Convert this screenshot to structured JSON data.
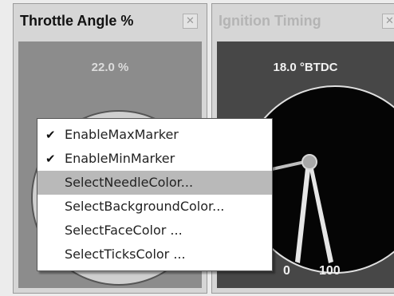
{
  "panels": {
    "throttle": {
      "title": "Throttle Angle  %",
      "close_icon": "close-icon",
      "readout": "22.0 %",
      "background_color": "#8c8c8c",
      "face_color": "#cfcfcf"
    },
    "ignition": {
      "title": "Ignition Timing",
      "close_icon": "close-icon",
      "readout": "18.0 °BTDC",
      "tick_min": "0",
      "tick_max": "100",
      "background_color": "#474747",
      "face_color": "#050505"
    }
  },
  "context_menu": {
    "items": [
      {
        "label": "EnableMaxMarker",
        "checked": true,
        "highlighted": false
      },
      {
        "label": "EnableMinMarker",
        "checked": true,
        "highlighted": false
      },
      {
        "label": "SelectNeedleColor...",
        "checked": false,
        "highlighted": true
      },
      {
        "label": "SelectBackgroundColor...",
        "checked": false,
        "highlighted": false
      },
      {
        "label": "SelectFaceColor ...",
        "checked": false,
        "highlighted": false
      },
      {
        "label": "SelectTicksColor ...",
        "checked": false,
        "highlighted": false
      }
    ],
    "check_icon": "checkmark-icon",
    "check_glyph": "✔"
  }
}
